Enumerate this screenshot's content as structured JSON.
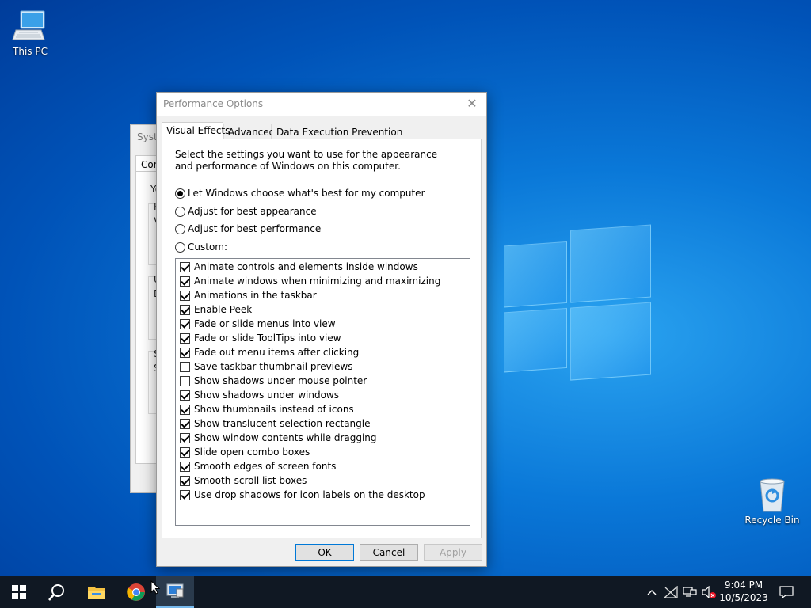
{
  "desktop": {
    "icons": [
      {
        "label": "This PC",
        "icon": "this-pc-icon"
      },
      {
        "label": "Recycle Bin",
        "icon": "recycle-bin-icon"
      }
    ]
  },
  "background_window": {
    "title": "Syste",
    "tab": "Com",
    "fragments": [
      "Yo",
      "P",
      "V",
      "U",
      "D",
      "S",
      "S"
    ]
  },
  "dialog": {
    "title": "Performance Options",
    "close_icon": "close-icon",
    "tabs": [
      {
        "label": "Visual Effects",
        "active": true
      },
      {
        "label": "Advanced",
        "active": false
      },
      {
        "label": "Data Execution Prevention",
        "active": false
      }
    ],
    "description": "Select the settings you want to use for the appearance and performance of Windows on this computer.",
    "radios": [
      {
        "label": "Let Windows choose what's best for my computer",
        "selected": true
      },
      {
        "label": "Adjust for best appearance",
        "selected": false
      },
      {
        "label": "Adjust for best performance",
        "selected": false
      },
      {
        "label": "Custom:",
        "selected": false
      }
    ],
    "effects": [
      {
        "label": "Animate controls and elements inside windows",
        "checked": true
      },
      {
        "label": "Animate windows when minimizing and maximizing",
        "checked": true
      },
      {
        "label": "Animations in the taskbar",
        "checked": true
      },
      {
        "label": "Enable Peek",
        "checked": true
      },
      {
        "label": "Fade or slide menus into view",
        "checked": true
      },
      {
        "label": "Fade or slide ToolTips into view",
        "checked": true
      },
      {
        "label": "Fade out menu items after clicking",
        "checked": true
      },
      {
        "label": "Save taskbar thumbnail previews",
        "checked": false
      },
      {
        "label": "Show shadows under mouse pointer",
        "checked": false
      },
      {
        "label": "Show shadows under windows",
        "checked": true
      },
      {
        "label": "Show thumbnails instead of icons",
        "checked": true
      },
      {
        "label": "Show translucent selection rectangle",
        "checked": true
      },
      {
        "label": "Show window contents while dragging",
        "checked": true
      },
      {
        "label": "Slide open combo boxes",
        "checked": true
      },
      {
        "label": "Smooth edges of screen fonts",
        "checked": true
      },
      {
        "label": "Smooth-scroll list boxes",
        "checked": true
      },
      {
        "label": "Use drop shadows for icon labels on the desktop",
        "checked": true
      }
    ],
    "buttons": {
      "ok": "OK",
      "cancel": "Cancel",
      "apply": "Apply",
      "apply_enabled": false
    }
  },
  "taskbar": {
    "items": [
      {
        "icon": "start-icon",
        "active": false
      },
      {
        "icon": "search-icon",
        "active": false
      },
      {
        "icon": "file-explorer-icon",
        "active": false
      },
      {
        "icon": "chrome-icon",
        "active": false
      },
      {
        "icon": "system-properties-icon",
        "active": true
      }
    ],
    "tray_icons": [
      "show-hidden-icons-chevron-icon",
      "network-disconnected-icon",
      "network-icon",
      "volume-muted-icon"
    ],
    "time": "9:04 PM",
    "date": "10/5/2023",
    "notification_icon": "action-center-icon"
  }
}
